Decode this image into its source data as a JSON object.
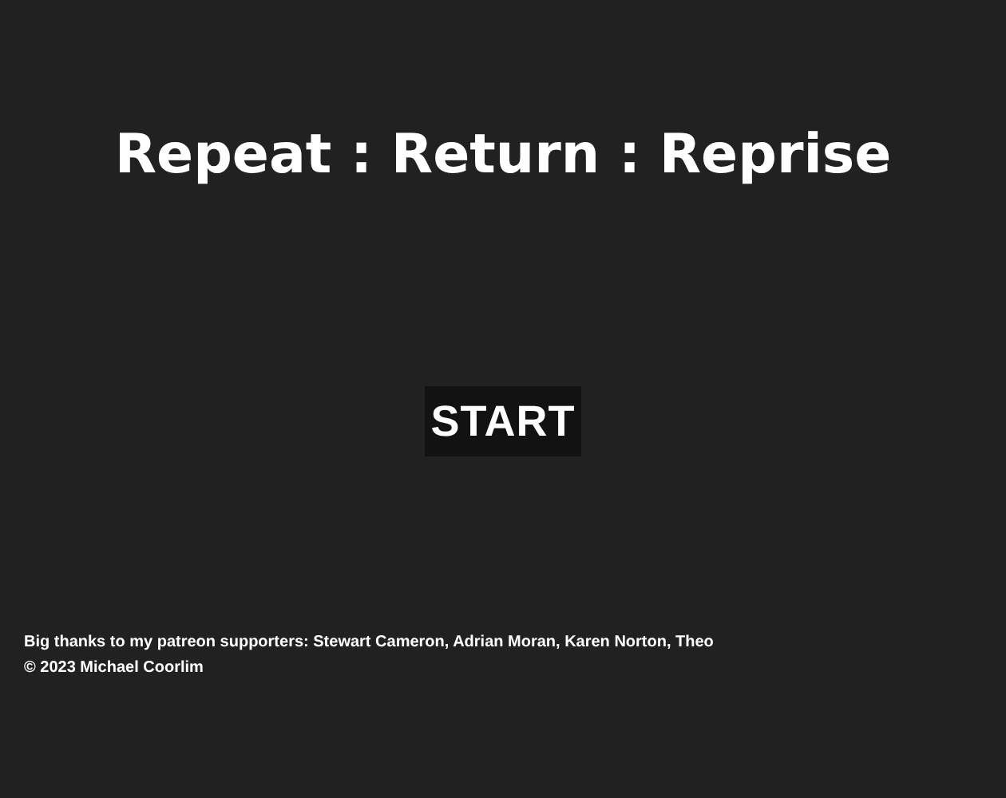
{
  "title": "Repeat : Return : Reprise",
  "start_button": "START",
  "credits": [
    "Big thanks to my patreon supporters: Stewart Cameron, Adrian Moran, Karen Norton, Theo",
    "© 2023 Michael Coorlim"
  ]
}
